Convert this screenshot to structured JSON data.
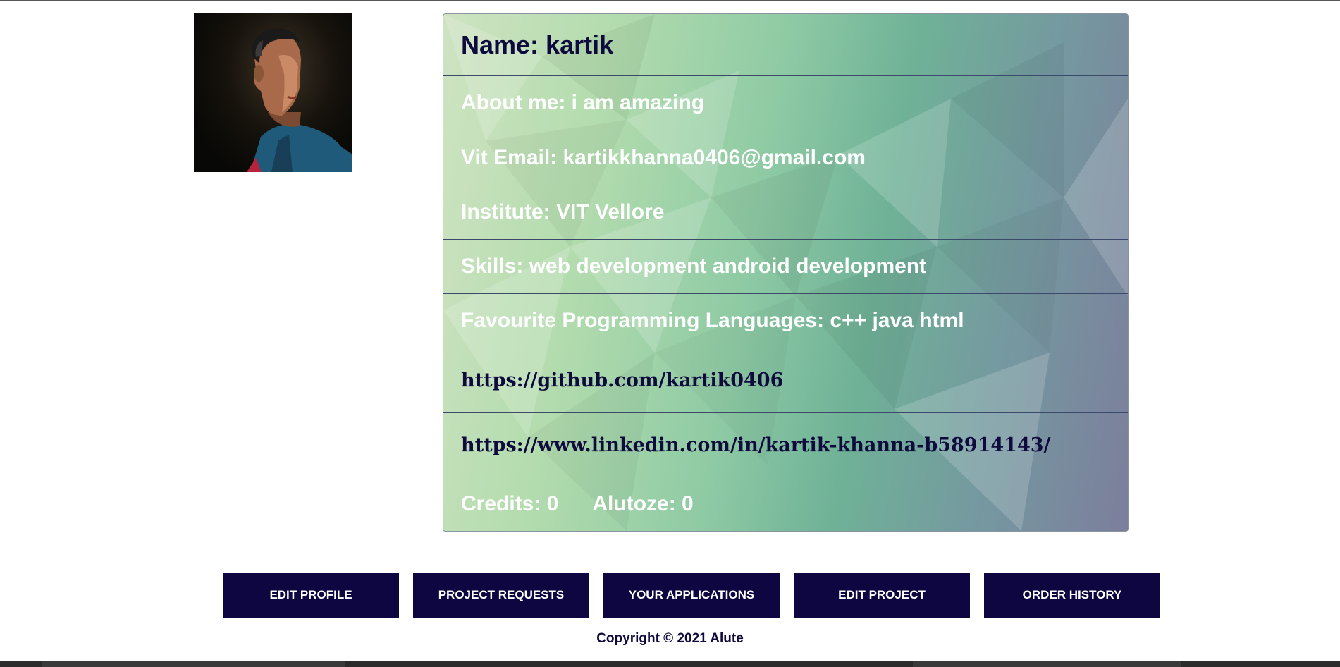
{
  "profile": {
    "avatar_alt": "profile photo",
    "name": "Name: kartik",
    "about": "About me: i am amazing",
    "email": "Vit Email: kartikkhanna0406@gmail.com",
    "institute": "Institute: VIT Vellore",
    "skills": "Skills: web development android development",
    "languages": "Favourite Programming Languages: c++ java html",
    "github": "https://github.com/kartik0406",
    "linkedin": "https://www.linkedin.com/in/kartik-khanna-b58914143/",
    "credits": "Credits: 0",
    "alutoze": "Alutoze: 0"
  },
  "actions": {
    "edit_profile": "EDIT PROFILE",
    "project_requests": "PROJECT REQUESTS",
    "your_applications": "YOUR APPLICATIONS",
    "edit_project": "EDIT PROJECT",
    "order_history": "ORDER HISTORY"
  },
  "footer": {
    "copyright": "Copyright © 2021 Alute"
  },
  "colors": {
    "button_bg": "#0d0640",
    "dark_text": "#0f0a3d",
    "card_gradient_start": "#cfe3c2",
    "card_gradient_end": "#7c7e9c"
  }
}
